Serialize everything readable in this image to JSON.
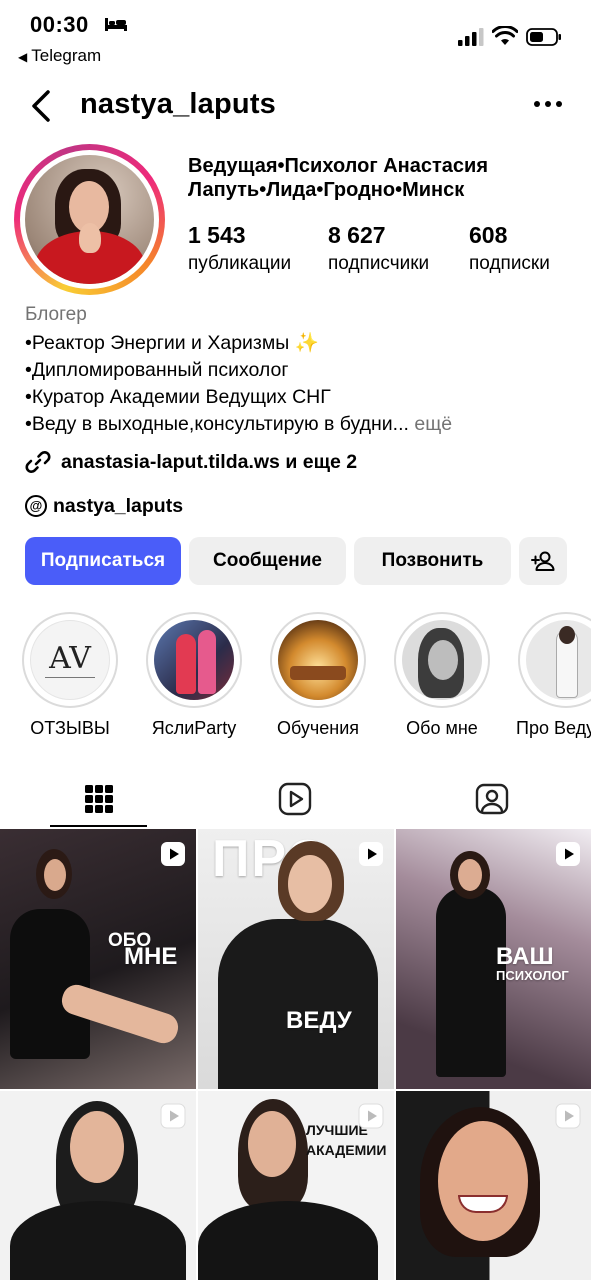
{
  "status_bar": {
    "time": "00:30",
    "back_app": "Telegram"
  },
  "header": {
    "username": "nastya_laputs"
  },
  "profile": {
    "full_name": "Ведущая•Психолог Анастасия Лапуть•Лида•Гродно•Минск",
    "stats": [
      {
        "value": "1 543",
        "label": "публикации"
      },
      {
        "value": "8 627",
        "label": "подписчики"
      },
      {
        "value": "608",
        "label": "подписки"
      }
    ],
    "category": "Блогер",
    "bio_lines": [
      "•Реактор Энергии и Харизмы ✨",
      "•Дипломированный психолог",
      "•Куратор Академии Ведущих СНГ",
      "•Веду в выходные,консультирую в будни..."
    ],
    "bio_more": "ещё",
    "link": "anastasia-laput.tilda.ws и еще 2",
    "threads": "nastya_laputs"
  },
  "buttons": {
    "follow": "Подписаться",
    "message": "Сообщение",
    "call": "Позвонить"
  },
  "highlights": [
    {
      "label": "ОТЗЫВЫ"
    },
    {
      "label": "ЯслиParty"
    },
    {
      "label": "Обучения"
    },
    {
      "label": "Обо мне"
    },
    {
      "label": "Про Ведущих"
    }
  ],
  "highlight_logo": {
    "monogram": "AV"
  },
  "grid": {
    "tiles": [
      {
        "text_line1": "ОБО",
        "text_line2": "МНЕ"
      },
      {
        "text_top": "ПРО",
        "text_line1": "ВЕДУ"
      },
      {
        "text_line1": "ВАШ",
        "text_line2": "ПСИХОЛОГ"
      },
      {},
      {
        "text_line1": "ЛУЧШИЕ",
        "text_line2": "АКАДЕМИИ"
      },
      {}
    ]
  },
  "colors": {
    "accent": "#4a5df9",
    "secondary_text": "#737373",
    "button_bg": "#efefef"
  }
}
